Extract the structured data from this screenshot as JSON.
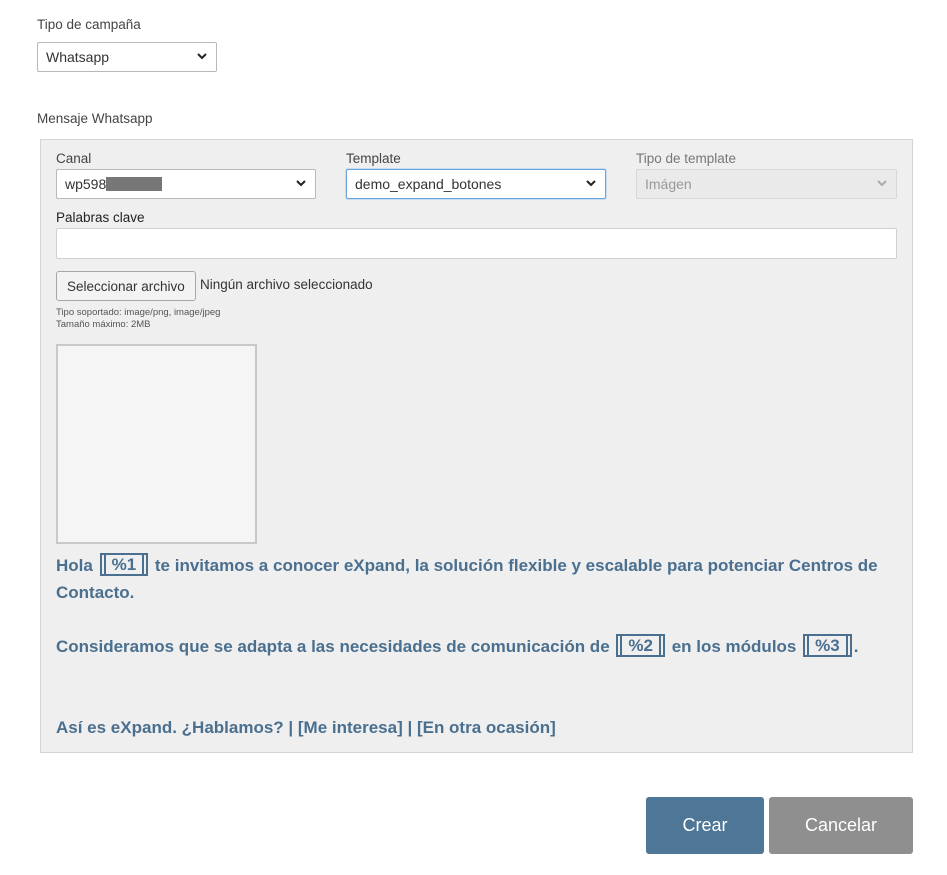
{
  "campaign_type": {
    "label": "Tipo de campaña",
    "value": "Whatsapp"
  },
  "section_title": "Mensaje Whatsapp",
  "canal": {
    "label": "Canal",
    "value": "wp598"
  },
  "template": {
    "label": "Template",
    "value": "demo_expand_botones"
  },
  "template_type": {
    "label": "Tipo de template",
    "value": "Imágen"
  },
  "keywords": {
    "label": "Palabras clave",
    "value": ""
  },
  "file": {
    "button_label": "Seleccionar archivo",
    "status": "Ningún archivo seleccionado",
    "supported": "Tipo soportado: image/png, image/jpeg",
    "max_size": "Tamaño máximo: 2MB"
  },
  "message": {
    "p1_a": "Hola",
    "var1": "%1",
    "p1_b": "te invitamos a conocer eXpand, la solución flexible y escalable para potenciar Centros de",
    "p1_c": "Contacto.",
    "p2_a": "Consideramos que se adapta a las necesidades de comunicación de",
    "var2": "%2",
    "p2_b": "en los módulos",
    "var3": "%3",
    "p2_c": ".",
    "p3": "Así es eXpand. ¿Hablamos? | [Me interesa] | [En otra ocasión]"
  },
  "actions": {
    "create": "Crear",
    "cancel": "Cancelar"
  },
  "colors": {
    "primary": "#4e7696",
    "secondary": "#8f8f8f",
    "message_text": "#4a6f8f"
  }
}
